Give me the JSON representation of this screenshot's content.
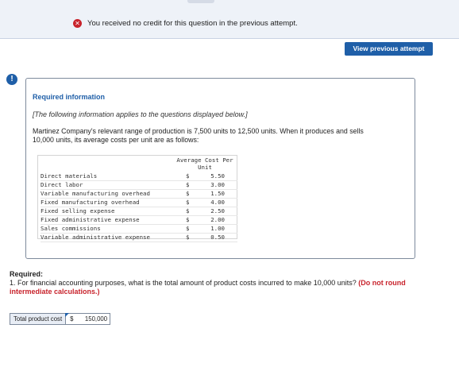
{
  "banner": {
    "message": "You received no credit for this question in the previous attempt.",
    "status_icon": "x-circle-icon",
    "status_color": "#c8232c"
  },
  "actions": {
    "view_previous": "View previous attempt"
  },
  "alert_icon": {
    "glyph": "!",
    "color": "#1f5fa8"
  },
  "info": {
    "title": "Required information",
    "subtitle": "[The following information applies to the questions displayed below.]",
    "description": "Martinez Company's relevant range of production is 7,500 units to 12,500 units. When it produces and sells 10,000 units, its average costs per unit are as follows:",
    "table": {
      "column_header_line1": "Average Cost Per",
      "column_header_line2": "Unit",
      "rows": [
        {
          "label": "Direct materials",
          "currency": "$",
          "value": "5.50"
        },
        {
          "label": "Direct labor",
          "currency": "$",
          "value": "3.00"
        },
        {
          "label": "Variable manufacturing overhead",
          "currency": "$",
          "value": "1.50"
        },
        {
          "label": "Fixed manufacturing overhead",
          "currency": "$",
          "value": "4.00"
        },
        {
          "label": "Fixed selling expense",
          "currency": "$",
          "value": "2.50"
        },
        {
          "label": "Fixed administrative expense",
          "currency": "$",
          "value": "2.00"
        },
        {
          "label": "Sales commissions",
          "currency": "$",
          "value": "1.00"
        },
        {
          "label": "Variable administrative expense",
          "currency": "$",
          "value": "0.50"
        }
      ]
    }
  },
  "question": {
    "required_label": "Required:",
    "text": "1. For financial accounting purposes, what is the total amount of product costs incurred to make 10,000 units?",
    "instruction": "(Do not round intermediate calculations.)"
  },
  "answer": {
    "label": "Total product cost",
    "currency": "$",
    "value": "150,000"
  }
}
